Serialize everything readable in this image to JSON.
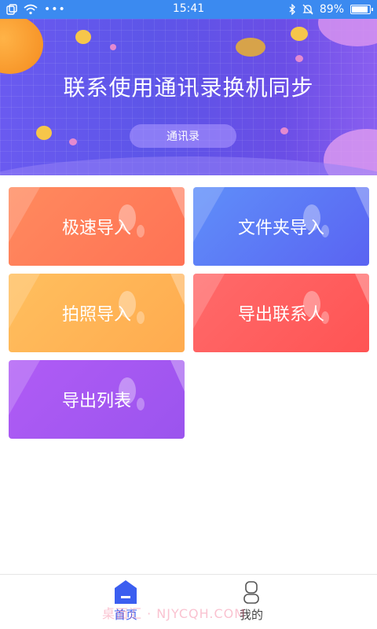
{
  "status_bar": {
    "time": "15:41",
    "battery": "89%",
    "battery_level": 0.89
  },
  "banner": {
    "title": "联系使用通讯录换机同步",
    "button_label": "通讯录"
  },
  "tiles": [
    {
      "label": "极速导入",
      "color": "#ff7b5a"
    },
    {
      "label": "文件夹导入",
      "color": "#5a78f5"
    },
    {
      "label": "拍照导入",
      "color": "#ffb554"
    },
    {
      "label": "导出联系人",
      "color": "#ff5e5e"
    },
    {
      "label": "导出列表",
      "color": "#a657f0"
    }
  ],
  "bottom_nav": {
    "items": [
      {
        "label": "首页",
        "icon": "home-icon",
        "active": true
      },
      {
        "label": "我的",
        "icon": "user-icon",
        "active": false
      }
    ],
    "watermark": "桌面汇 · NJYCQH.COM"
  },
  "colors": {
    "status_bar": "#3b8af0",
    "active_nav": "#3b5ef0"
  }
}
